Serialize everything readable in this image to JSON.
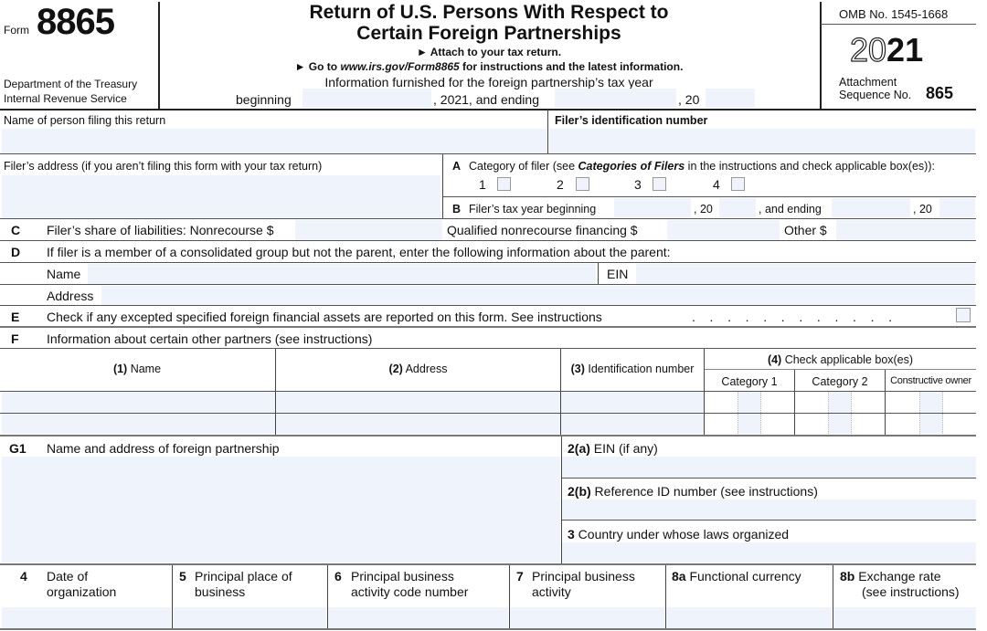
{
  "header": {
    "form_label": "Form",
    "form_number": "8865",
    "department_line1": "Department of the Treasury",
    "department_line2": "Internal Revenue Service",
    "title_line1": "Return of U.S. Persons With Respect to",
    "title_line2": "Certain Foreign Partnerships",
    "attach_note": "► Attach to your tax return.",
    "goto_prefix": "► Go to ",
    "goto_url": "www.irs.gov/Form8865",
    "goto_suffix": " for instructions and the latest information.",
    "info_furnished": "Information furnished for the foreign partnership’s tax year",
    "beginning_label": "beginning",
    "year_mid_label": ", 2021, and ending",
    "year_end_label": ", 20",
    "omb": "OMB No. 1545-1668",
    "year_outline": "20",
    "year_bold": "21",
    "attachment_line1": "Attachment",
    "attachment_line2": "Sequence No.",
    "sequence_no": "865"
  },
  "filer": {
    "name_label": "Name of person filing this return",
    "id_label": "Filer’s identification number",
    "address_label": "Filer’s address (if you aren’t filing this form with your tax return)",
    "a_letter": "A",
    "a_text_prefix": "Category of filer (see ",
    "a_text_italic": "Categories of Filers",
    "a_text_suffix": " in the instructions and check applicable box(es)):",
    "categories": [
      "1",
      "2",
      "3",
      "4"
    ],
    "b_letter": "B",
    "b_text": "Filer’s tax year beginning",
    "b_mid": ", 20",
    "b_and_ending": ", and ending",
    "b_end": ", 20"
  },
  "line_c": {
    "letter": "C",
    "nonrecourse": "Filer’s share of liabilities: Nonrecourse $",
    "qualified": "Qualified nonrecourse financing $",
    "other": "Other $"
  },
  "line_d": {
    "letter": "D",
    "text": "If filer is a member of a consolidated group but not the parent, enter the following information about the parent:",
    "name_label": "Name",
    "ein_label": "EIN",
    "address_label": "Address"
  },
  "line_e": {
    "letter": "E",
    "text": "Check if any excepted specified foreign financial assets are reported on this form. See instructions",
    "dots": ".   .   .   .   .   .   .   .   .   .   .   ."
  },
  "line_f": {
    "letter": "F",
    "text": "Information about certain other partners (see instructions)",
    "col1_num": "(1)",
    "col1": " Name",
    "col2_num": "(2)",
    "col2": " Address",
    "col3_num": "(3)",
    "col3": " Identification number",
    "col4_num": "(4)",
    "col4": " Check applicable box(es)",
    "sub_cat1": "Category 1",
    "sub_cat2": "Category 2",
    "sub_constructive": "Constructive owner"
  },
  "line_g": {
    "letter": "G1",
    "text": "Name and address of foreign partnership",
    "ein_num": "2(a)",
    "ein_text": " EIN (if any)",
    "ref_num": "2(b)",
    "ref_text": " Reference ID number (see instructions)",
    "country_num": "3",
    "country_text": " Country under whose laws organized"
  },
  "bottom": {
    "c4_num": "4",
    "c4_l1": "Date of",
    "c4_l2": "organization",
    "c5_num": "5",
    "c5_l1": "Principal place of",
    "c5_l2": "business",
    "c6_num": "6",
    "c6_l1": "Principal business",
    "c6_l2": "activity code number",
    "c7_num": "7",
    "c7_l1": "Principal business",
    "c7_l2": "activity",
    "c8a_num": "8a",
    "c8a_l1": "Functional currency",
    "c8b_num": "8b",
    "c8b_l1": "Exchange rate",
    "c8b_l2": "(see instructions)"
  }
}
